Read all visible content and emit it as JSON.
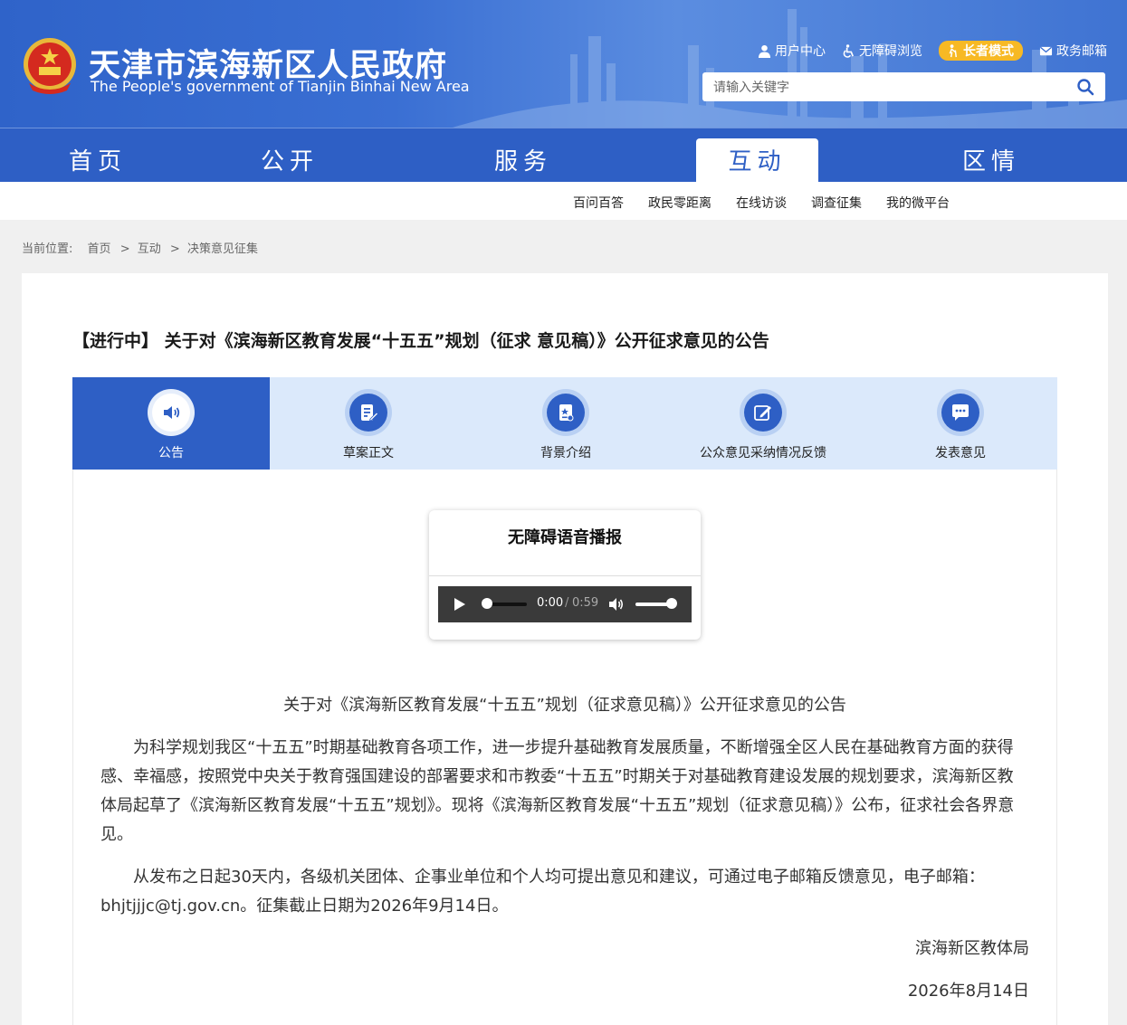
{
  "header": {
    "title": "天津市滨海新区人民政府",
    "subtitle": "The People's government of Tianjin Binhai New Area",
    "links": [
      {
        "icon": "user-icon",
        "label": "用户中心"
      },
      {
        "icon": "wheelchair-icon",
        "label": "无障碍浏览"
      },
      {
        "icon": "elder-icon",
        "label": "长者模式"
      },
      {
        "icon": "mail-icon",
        "label": "政务邮箱"
      }
    ],
    "search": {
      "placeholder": "请输入关键字",
      "value": ""
    }
  },
  "nav": {
    "items": [
      "首页",
      "公开",
      "服务",
      "互动",
      "区情"
    ],
    "active": "互动"
  },
  "subnav": {
    "items": [
      "百问百答",
      "政民零距离",
      "在线访谈",
      "调查征集",
      "我的微平台"
    ]
  },
  "breadcrumb": {
    "prefix": "当前位置:",
    "items": [
      "首页",
      "互动",
      "决策意见征集"
    ],
    "separator": ">"
  },
  "article": {
    "title": "【进行中】 关于对《滨海新区教育发展“十五五”规划（征求 意见稿）》公开征求意见的公告",
    "tabs": [
      {
        "icon": "speaker-icon",
        "label": "公告"
      },
      {
        "icon": "document-edit-icon",
        "label": "草案正文"
      },
      {
        "icon": "background-info-icon",
        "label": "背景介绍"
      },
      {
        "icon": "pen-feedback-icon",
        "label": "公众意见采纳情况反馈"
      },
      {
        "icon": "chat-icon",
        "label": "发表意见"
      }
    ],
    "active_tab": "公告",
    "audio": {
      "title": "无障碍语音播报",
      "current_time": "0:00",
      "separator": "/",
      "duration": "0:59",
      "progress": 0,
      "volume": 1
    },
    "sub_heading": "关于对《滨海新区教育发展“十五五”规划（征求意见稿）》公开征求意见的公告",
    "paragraphs": [
      "为科学规划我区“十五五”时期基础教育各项工作，进一步提升基础教育发展质量，不断增强全区人民在基础教育方面的获得感、幸福感，按照党中央关于教育强国建设的部署要求和市教委“十五五”时期关于对基础教育建设发展的规划要求，滨海新区教体局起草了《滨海新区教育发展“十五五”规划》。现将《滨海新区教育发展“十五五”规划（征求意见稿）》公布，征求社会各界意见。",
      "从发布之日起30天内，各级机关团体、企事业单位和个人均可提出意见和建议，可通过电子邮箱反馈意见，电子邮箱：bhjtjjjc@tj.gov.cn。征集截止日期为2026年9月14日。"
    ],
    "signature": "滨海新区教体局",
    "date": "2026年8月14日"
  },
  "colors": {
    "brand_blue": "#2e5fc5",
    "tab_bg": "#dbe9fb",
    "elder_badge": "#f7b924",
    "player_bg": "#3a3a3a"
  }
}
